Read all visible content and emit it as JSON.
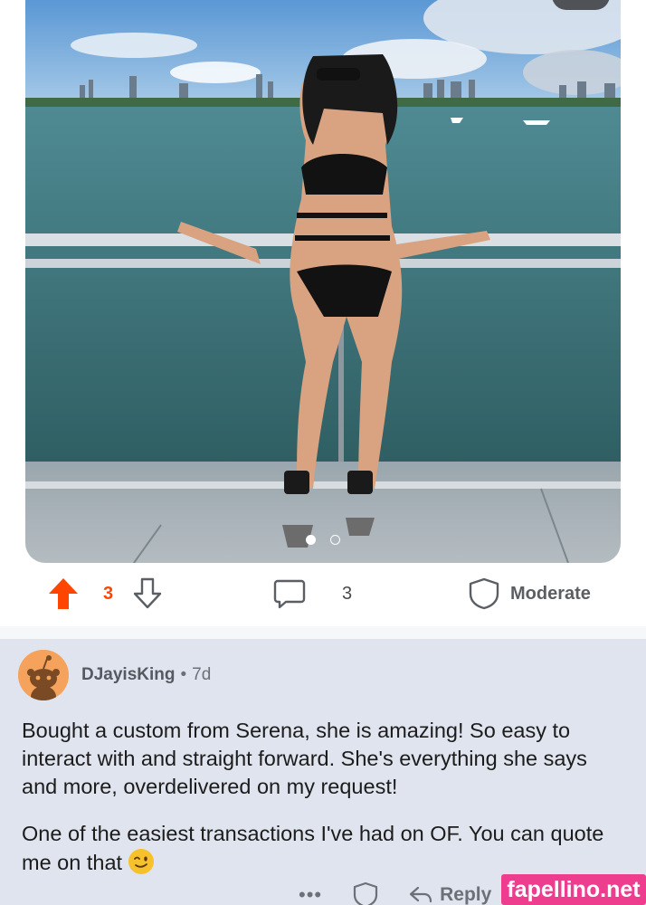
{
  "post": {
    "image_counter": "1/2",
    "image_count": 2,
    "active_image_index": 0
  },
  "actions": {
    "vote_count": "3",
    "comment_count": "3",
    "moderate_label": "Moderate"
  },
  "comment": {
    "username": "DJayisKing",
    "separator": "•",
    "age": "7d",
    "paragraph_1": "Bought a custom from Serena, she is amazing! So easy to interact with and straight forward. She's everything she says and more, overdelivered on my request!",
    "paragraph_2": "One of the easiest transactions I've had on OF. You can quote me on that",
    "emoji": "winking-face",
    "more_label": "•••",
    "reply_label": "Reply"
  },
  "watermark": "fapellino.net",
  "colors": {
    "upvote_active": "#ff4500",
    "comment_background": "#dfe4ee",
    "avatar_background": "#f5a35c",
    "watermark_background": "#ee3d8f"
  }
}
